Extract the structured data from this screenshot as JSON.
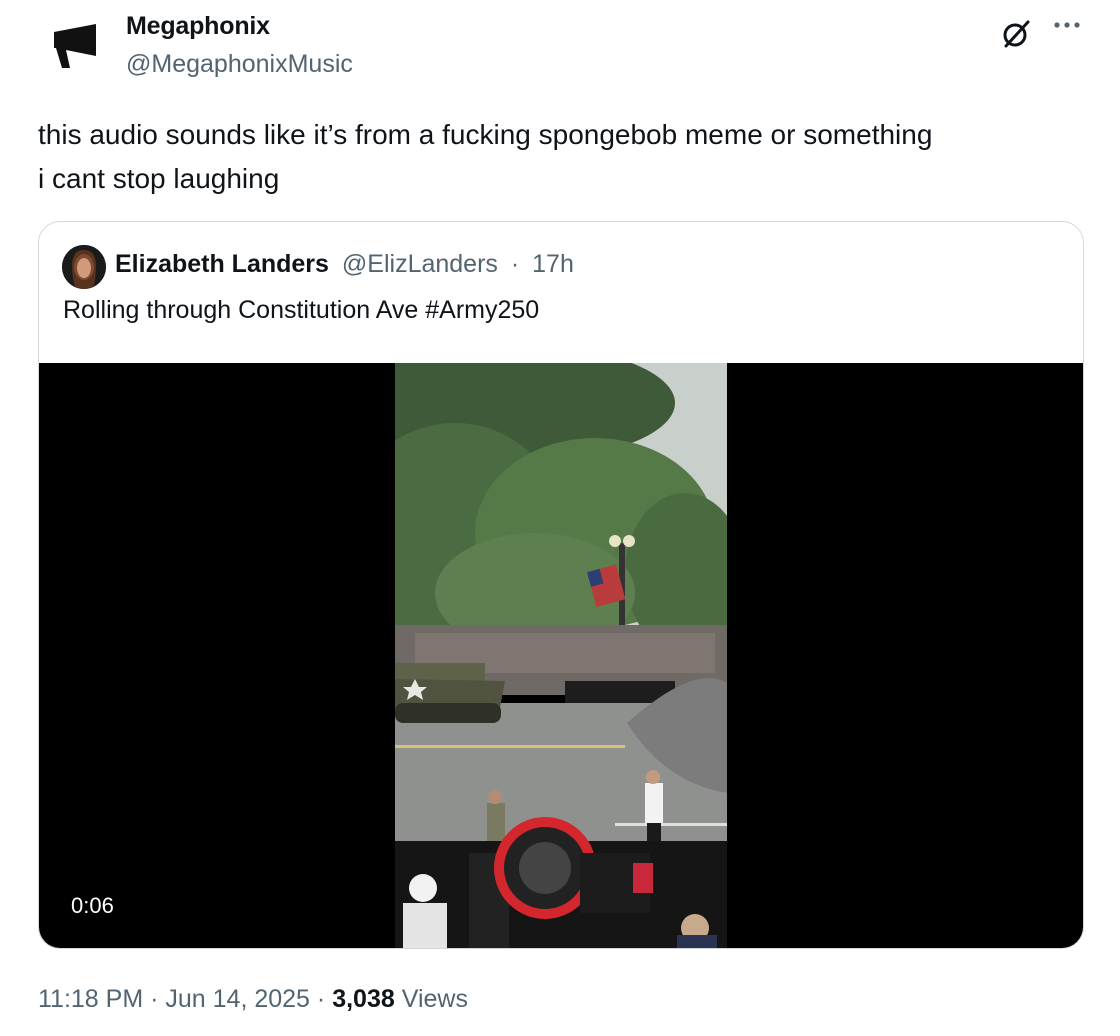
{
  "author": {
    "display_name": "Megaphonix",
    "handle": "@MegaphonixMusic",
    "avatar_icon": "megaphone-icon"
  },
  "header_actions": {
    "grok_icon": "grok-icon",
    "more_icon": "more-dots-icon"
  },
  "tweet": {
    "text_line1": "this audio sounds like it’s from a fucking spongebob meme or something",
    "text_line2": "i cant stop laughing"
  },
  "quote": {
    "display_name": "Elizabeth Landers",
    "handle": "@ElizLanders",
    "separator": "·",
    "age": "17h",
    "text": "Rolling through Constitution Ave #Army250",
    "video_duration": "0:06"
  },
  "meta": {
    "time": "11:18 PM",
    "dot1": "·",
    "date": "Jun 14, 2025",
    "dot2": "·",
    "views_count": "3,038",
    "views_label": "Views"
  },
  "colors": {
    "text_primary": "#0f1419",
    "text_secondary": "#536471",
    "border": "#cfd9de",
    "video_bg": "#000000"
  }
}
